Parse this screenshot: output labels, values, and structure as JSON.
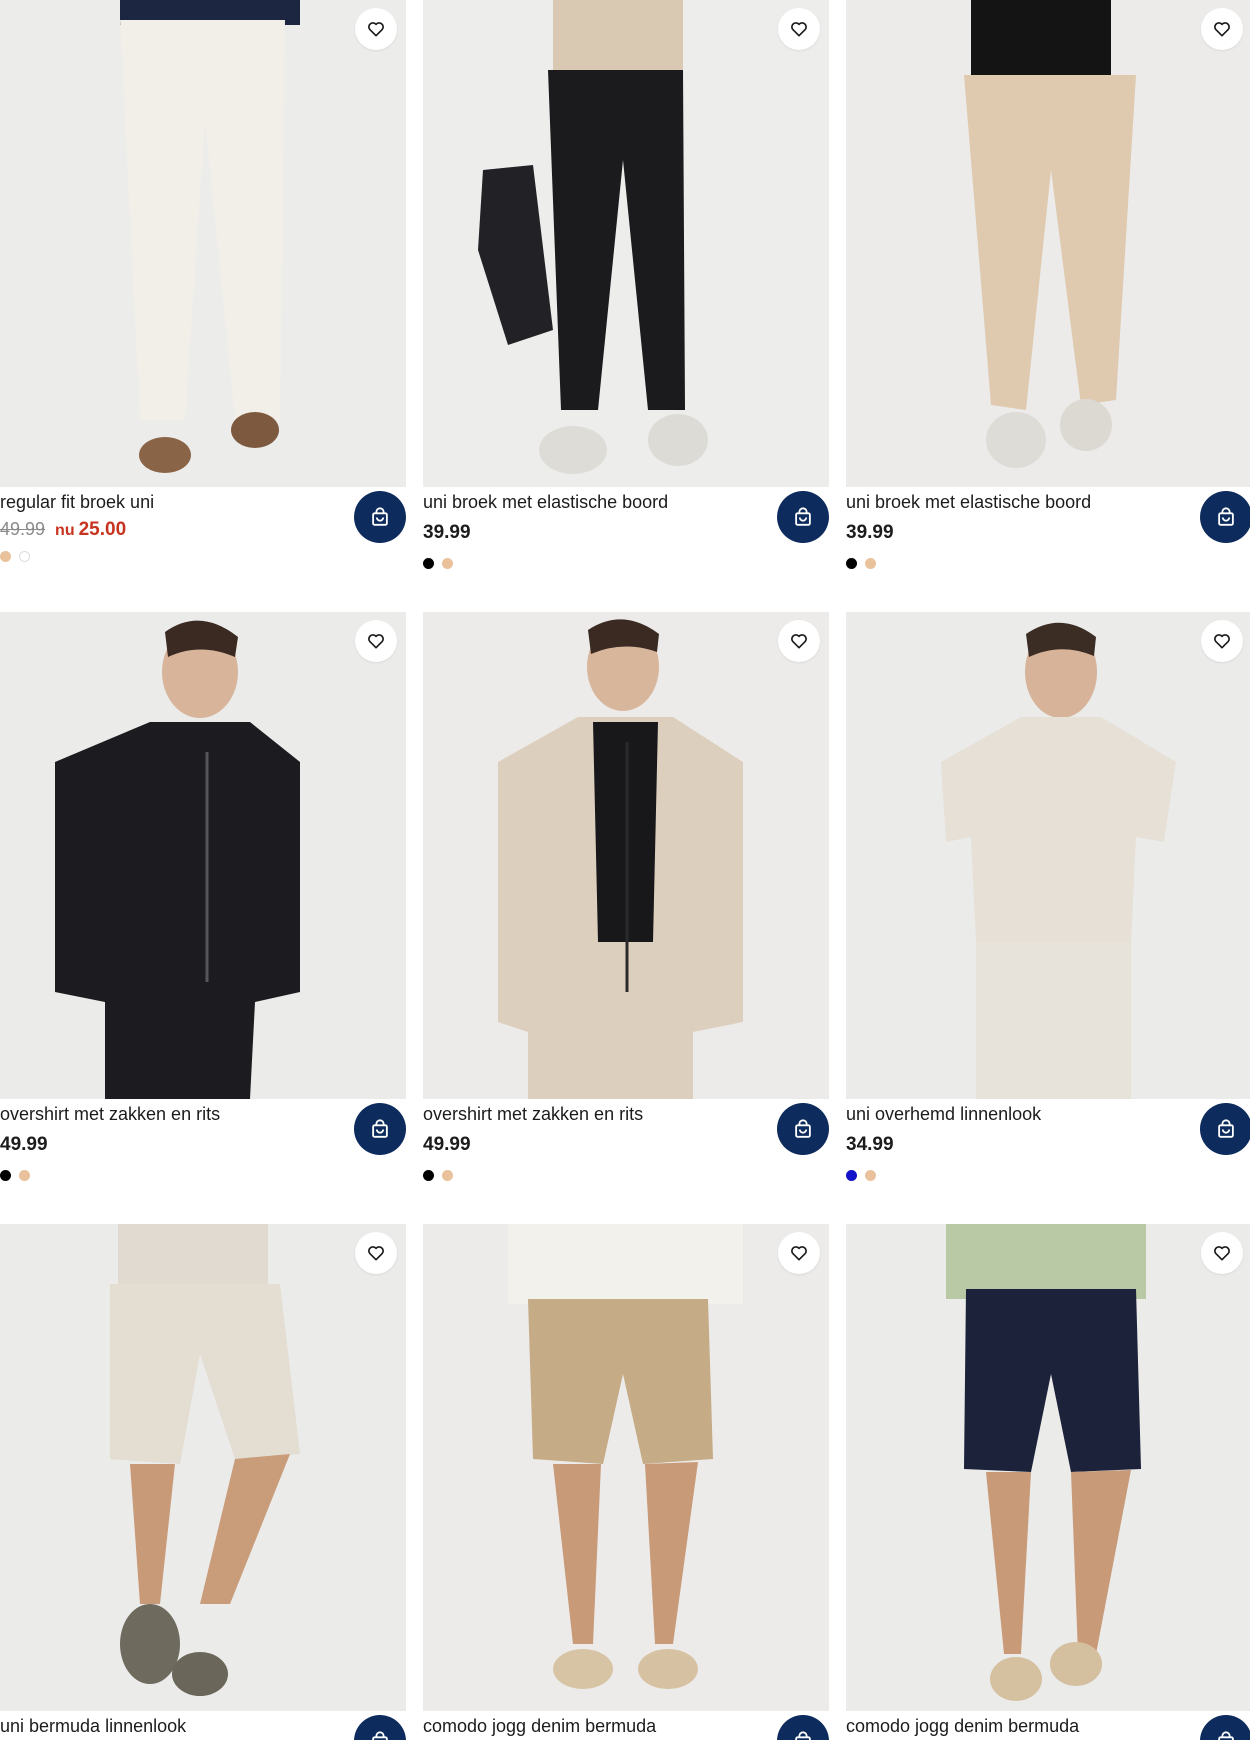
{
  "products": [
    {
      "name": "regular fit broek uni",
      "old_price": "49.99",
      "nu_label": "nu",
      "new_price": "25.00",
      "price": "",
      "swatches": [
        "#e9c29c",
        "#ffffff"
      ],
      "garment_color": "#f1efe8",
      "type": "pants"
    },
    {
      "name": "uni broek met elastische boord",
      "price": "39.99",
      "swatches": [
        "#000000",
        "#e9c29c"
      ],
      "garment_color": "#1b1b1d",
      "type": "pants"
    },
    {
      "name": "uni broek met elastische boord",
      "price": "39.99",
      "swatches": [
        "#000000",
        "#e9c29c"
      ],
      "garment_color": "#dfcab0",
      "type": "pants"
    },
    {
      "name": "overshirt met zakken en rits",
      "price": "49.99",
      "swatches": [
        "#000000",
        "#e9c29c"
      ],
      "garment_color": "#1c1c20",
      "type": "jacket"
    },
    {
      "name": "overshirt met zakken en rits",
      "price": "49.99",
      "swatches": [
        "#000000",
        "#e9c29c"
      ],
      "garment_color": "#ddcfbd",
      "type": "jacket"
    },
    {
      "name": "uni overhemd linnenlook",
      "price": "34.99",
      "swatches": [
        "#1212c8",
        "#e9c29c"
      ],
      "garment_color": "#e6e0d6",
      "type": "shirt"
    },
    {
      "name": "uni bermuda linnenlook",
      "price": "",
      "swatches": [],
      "garment_color": "#e3ddd2",
      "type": "shorts"
    },
    {
      "name": "comodo jogg denim bermuda",
      "price": "",
      "swatches": [],
      "garment_color": "#c6ac86",
      "type": "shorts"
    },
    {
      "name": "comodo jogg denim bermuda",
      "price": "",
      "swatches": [],
      "garment_color": "#1b2239",
      "type": "shorts"
    }
  ],
  "icons": {
    "favorite": "heart-icon",
    "cart": "shopping-bag-icon"
  },
  "colors": {
    "cart_button": "#0d2b5c",
    "sale_price": "#c7331f"
  }
}
